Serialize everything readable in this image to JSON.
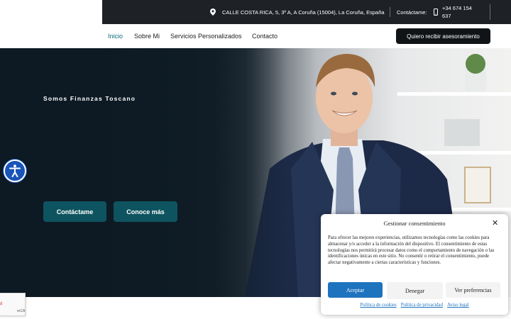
{
  "topbar": {
    "address": "CALLE COSTA RICA, 5, 3º A, A Coruña (15004), La Coruña, España",
    "contact_label": "Contáctame:",
    "phone_line1": "+34 674 154",
    "phone_line2": "637"
  },
  "nav": {
    "items": [
      {
        "label": "Inicio",
        "active": true
      },
      {
        "label": "Sobre Mi",
        "active": false
      },
      {
        "label": "Servicios Personalizados",
        "active": false
      },
      {
        "label": "Contacto",
        "active": false
      }
    ],
    "cta": "Quiero recibir asesoramiento"
  },
  "hero": {
    "title": "Somos Finanzas Toscano",
    "buttons": [
      "Contáctame",
      "Conoce más"
    ]
  },
  "recaptcha": {
    "text": "reCA"
  },
  "consent": {
    "title": "Gestionar consentimiento",
    "body": "Para ofrecer las mejores experiencias, utilizamos tecnologías como las cookies para almacenar y/o acceder a la información del dispositivo. El consentimiento de estas tecnologías nos permitirá procesar datos como el comportamiento de navegación o las identificaciones únicas en este sitio. No consentir o retirar el consentimiento, puede afectar negativamente a ciertas características y funciones.",
    "accept": "Aceptar",
    "deny": "Denegar",
    "prefs": "Ver preferencias",
    "links": [
      "Política de cookies",
      "Política de privacidad",
      "Aviso legal"
    ]
  },
  "colors": {
    "accent": "#0f6e79",
    "button_teal": "#0e5460",
    "accept_blue": "#1e73be",
    "topbar_bg": "#1e2226"
  },
  "icons": [
    "map-marker-icon",
    "phone-icon",
    "accessibility-icon",
    "close-icon"
  ]
}
